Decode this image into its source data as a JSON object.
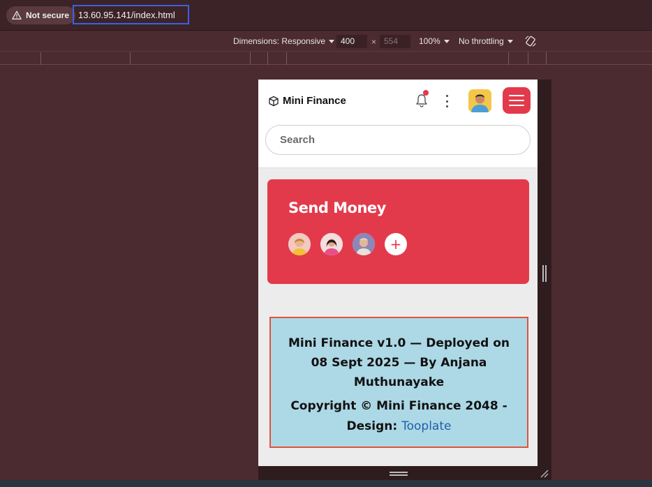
{
  "browser": {
    "security_label": "Not secure",
    "url": "13.60.95.141/index.html"
  },
  "device_toolbar": {
    "dimensions_label": "Dimensions: Responsive",
    "width": "400",
    "times": "×",
    "height": "554",
    "zoom": "100%",
    "throttling": "No throttling"
  },
  "site": {
    "brand": "Mini Finance",
    "search_placeholder": "Search"
  },
  "send_money": {
    "title": "Send Money",
    "add_symbol": "+"
  },
  "footer": {
    "line1": "Mini Finance v1.0 — Deployed on 08 Sept 2025 — By Anjana Muthunayake",
    "copyright": "Copyright © Mini Finance 2048 - Design: ",
    "design_link": "Tooplate"
  },
  "colors": {
    "accent_red": "#e33a4b",
    "footer_bg": "#add8e6",
    "footer_border": "#e0533d",
    "devtools_bg": "#4b2a30"
  }
}
